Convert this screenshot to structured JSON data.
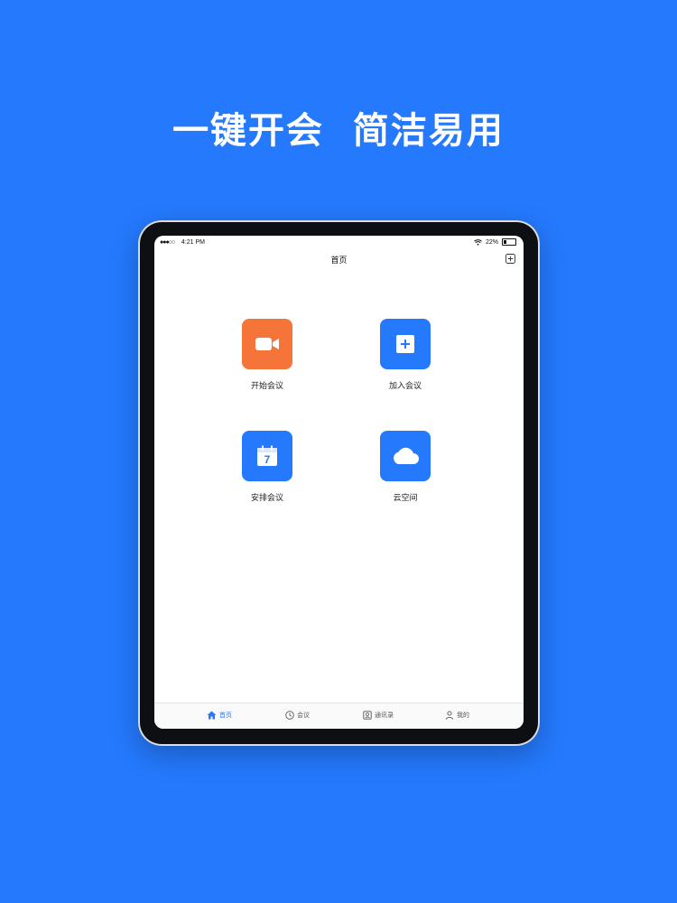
{
  "headline": "一键开会  简洁易用",
  "status_bar": {
    "signal": "●●●○○",
    "time": "4:21 PM",
    "battery": "22%",
    "battery_level": 0.22
  },
  "nav": {
    "title": "首页",
    "add_icon": "plus-square-icon"
  },
  "actions": [
    {
      "label": "开始会议",
      "icon": "video-camera-icon",
      "color": "#f4743a"
    },
    {
      "label": "加入会议",
      "icon": "plus-square-icon",
      "color": "#2479fd"
    },
    {
      "label": "安排会议",
      "icon": "calendar-icon",
      "color": "#2479fd",
      "icon_text": "7"
    },
    {
      "label": "云空间",
      "icon": "cloud-icon",
      "color": "#2479fd"
    }
  ],
  "tabs": [
    {
      "label": "首页",
      "icon": "home-icon",
      "active": true
    },
    {
      "label": "会议",
      "icon": "clock-icon",
      "active": false
    },
    {
      "label": "通讯录",
      "icon": "contacts-icon",
      "active": false
    },
    {
      "label": "我的",
      "icon": "user-icon",
      "active": false
    }
  ],
  "colors": {
    "background": "#2479fd",
    "accent": "#2479fd",
    "start_tile": "#f4743a"
  }
}
